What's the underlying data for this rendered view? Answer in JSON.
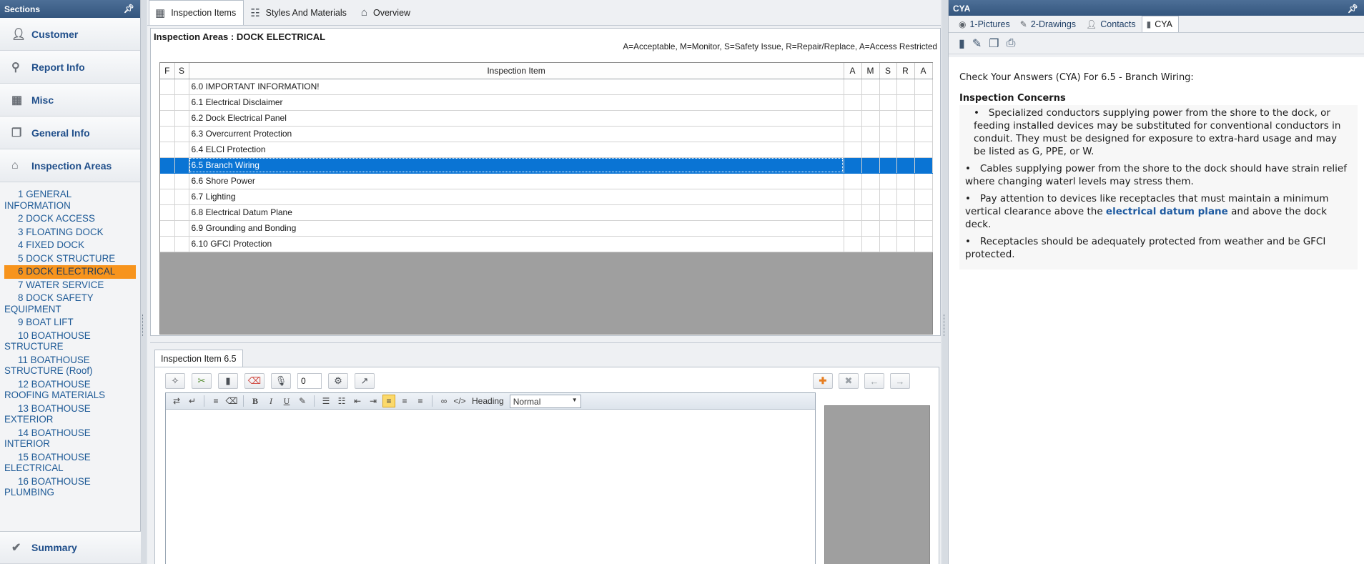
{
  "sections": {
    "title": "Sections",
    "buttons": [
      {
        "label": "Customer",
        "icon": "person-icon"
      },
      {
        "label": "Report Info",
        "icon": "key-icon"
      },
      {
        "label": "Misc",
        "icon": "grid-icon"
      },
      {
        "label": "General Info",
        "icon": "documents-icon"
      },
      {
        "label": "Inspection Areas",
        "icon": "home-icon"
      }
    ],
    "areas": [
      {
        "num": "1",
        "label": "GENERAL INFORMATION"
      },
      {
        "num": "2",
        "label": "DOCK ACCESS"
      },
      {
        "num": "3",
        "label": "FLOATING DOCK"
      },
      {
        "num": "4",
        "label": "FIXED DOCK"
      },
      {
        "num": "5",
        "label": "DOCK STRUCTURE"
      },
      {
        "num": "6",
        "label": "DOCK ELECTRICAL"
      },
      {
        "num": "7",
        "label": "WATER SERVICE"
      },
      {
        "num": "8",
        "label": "DOCK SAFETY EQUIPMENT"
      },
      {
        "num": "9",
        "label": "BOAT LIFT"
      },
      {
        "num": "10",
        "label": "BOATHOUSE STRUCTURE"
      },
      {
        "num": "11",
        "label": "BOATHOUSE STRUCTURE (Roof)"
      },
      {
        "num": "12",
        "label": "BOATHOUSE ROOFING MATERIALS"
      },
      {
        "num": "13",
        "label": "BOATHOUSE EXTERIOR"
      },
      {
        "num": "14",
        "label": "BOATHOUSE INTERIOR"
      },
      {
        "num": "15",
        "label": "BOATHOUSE ELECTRICAL"
      },
      {
        "num": "16",
        "label": "BOATHOUSE PLUMBING"
      }
    ],
    "selected_area": "6",
    "summary_label": "Summary"
  },
  "center": {
    "tabs": [
      {
        "label": "Inspection Items",
        "icon": "table-icon",
        "active": true
      },
      {
        "label": "Styles And Materials",
        "icon": "list-table-icon",
        "active": false
      },
      {
        "label": "Overview",
        "icon": "home-icon",
        "active": false
      }
    ],
    "areas_title": "Inspection Areas : DOCK ELECTRICAL",
    "legend": "A=Acceptable, M=Monitor, S=Safety Issue, R=Repair/Replace, A=Access Restricted",
    "columns": [
      "F",
      "S",
      "Inspection Item",
      "A",
      "M",
      "S",
      "R",
      "A"
    ],
    "items": [
      "6.0 IMPORTANT INFORMATION!",
      "6.1 Electrical Disclaimer",
      "6.2 Dock Electrical Panel",
      "6.3 Overcurrent Protection",
      "6.4 ELCI Protection",
      "6.5 Branch Wiring",
      "6.6 Shore Power",
      "6.7 Lighting",
      "6.8 Electrical Datum Plane",
      "6.9 Grounding and Bonding",
      "6.10 GFCI Protection"
    ],
    "selected_item_index": 5
  },
  "editor": {
    "tab_label": "Inspection Item 6.5",
    "counter_value": "0",
    "heading_label": "Heading",
    "heading_value": "Normal"
  },
  "cya": {
    "title": "CYA",
    "tabs": [
      {
        "label": "1-Pictures",
        "icon": "camera-icon"
      },
      {
        "label": "2-Drawings",
        "icon": "pencil-icon"
      },
      {
        "label": "Contacts",
        "icon": "person-icon"
      },
      {
        "label": "CYA",
        "icon": "book-icon"
      }
    ],
    "intro": "Check Your Answers (CYA) For 6.5 - Branch Wiring:",
    "concerns_heading": "Inspection Concerns",
    "bullet1": "Specialized conductors supplying power from the shore to the dock, or feeding installed devices may be substituted for conventional conductors in conduit. They must be designed for exposure to extra-hard usage and may be listed as G, PPE, or W.",
    "bullet2": "Cables supplying power from the shore to the dock should have strain relief where changing waterl levels may stress them.",
    "bullet3_pre": "Pay attention to devices like receptacles that must maintain a minimum vertical clearance above the",
    "bullet3_link": "electrical datum plane",
    "bullet3_post": "and above the dock deck.",
    "bullet4": "Receptacles should be adequately protected from weather and be GFCI protected."
  }
}
